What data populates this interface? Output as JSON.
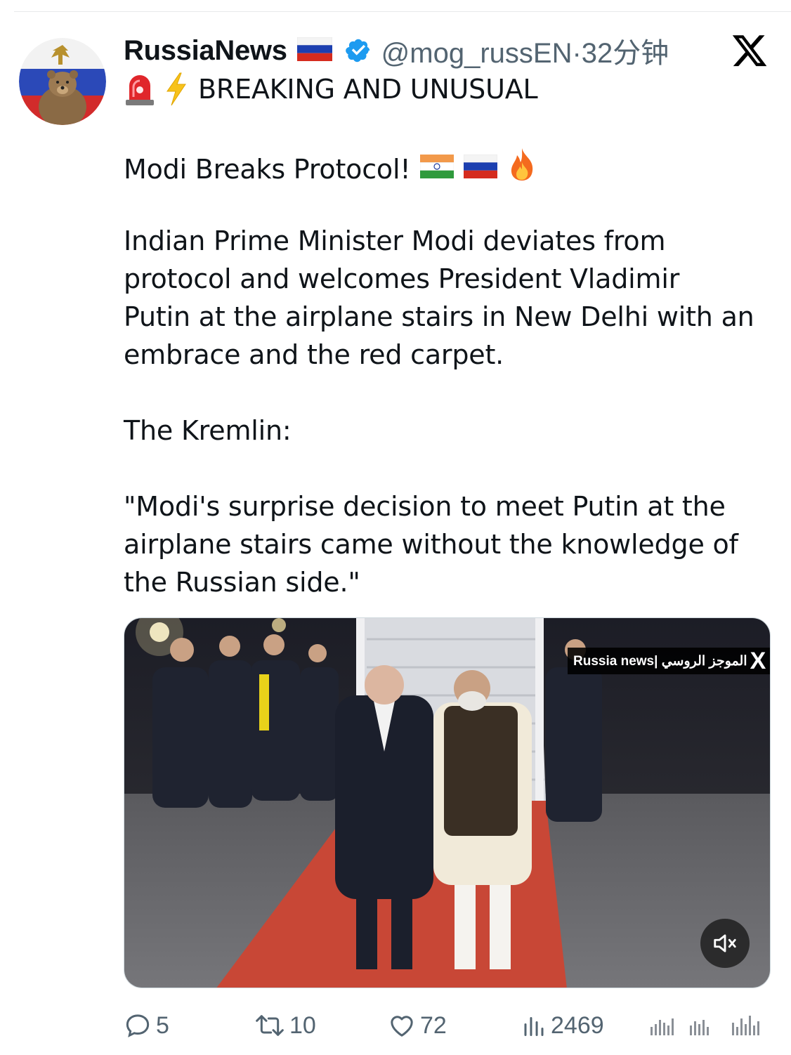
{
  "tweet": {
    "display_name": "RussiaNews",
    "handle": "@mog_russEN",
    "separator": "·",
    "time_ago": "32分钟",
    "breaking": "BREAKING AND UNUSUAL",
    "headline": "Modi Breaks Protocol!",
    "body_lines": [
      "Indian Prime Minister Modi deviates from",
      "protocol and welcomes President Vladimir",
      "Putin at the airplane stairs in New Delhi with an",
      "embrace and the red carpet."
    ],
    "kremlin_label": "The Kremlin:",
    "quote_lines": [
      "\"Modi's surprise decision to meet Putin at the",
      "airplane stairs came without the knowledge of",
      "the Russian side.\""
    ]
  },
  "media": {
    "watermark_text": "Russia news| الموجز الروسي",
    "watermark_logo": "X"
  },
  "actions": {
    "replies": "5",
    "retweets": "10",
    "likes": "72",
    "views": "2469"
  },
  "icons": {
    "siren": "police-siren-emoji",
    "bolt": "high-voltage-emoji",
    "verified": "verified-badge-icon",
    "brand": "x-logo-icon",
    "mute": "volume-muted-icon"
  },
  "colors": {
    "text": "#0f1419",
    "muted": "#536471",
    "verified_blue": "#1d9bf0"
  }
}
